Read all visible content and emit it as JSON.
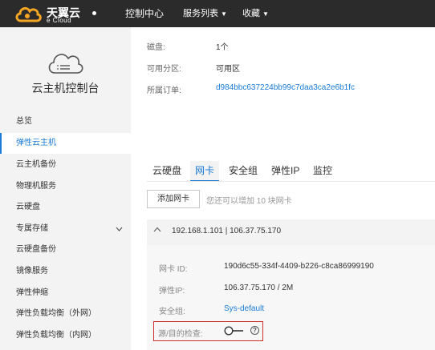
{
  "header": {
    "brand": "天翼云",
    "brand_sub": "e Cloud",
    "nav": [
      "控制中心",
      "服务列表",
      "收藏"
    ]
  },
  "sidebar": {
    "title": "云主机控制台",
    "items": [
      {
        "label": "总览"
      },
      {
        "label": "弹性云主机",
        "active": true
      },
      {
        "label": "云主机备份"
      },
      {
        "label": "物理机服务"
      },
      {
        "label": "云硬盘"
      },
      {
        "label": "专属存储",
        "expandable": true
      },
      {
        "label": "云硬盘备份"
      },
      {
        "label": "镜像服务"
      },
      {
        "label": "弹性伸缩"
      },
      {
        "label": "弹性负载均衡（外网）"
      },
      {
        "label": "弹性负载均衡（内网）"
      }
    ]
  },
  "details": [
    {
      "label": "磁盘:",
      "value": "1个"
    },
    {
      "label": "可用分区:",
      "value": "可用区"
    },
    {
      "label": "所属订单:",
      "value": "d984bbc637224bb99c7daa3ca2e6b1fc"
    }
  ],
  "tabs": [
    "云硬盘",
    "网卡",
    "安全组",
    "弹性IP",
    "监控"
  ],
  "active_tab": "网卡",
  "add_nic_button": "添加网卡",
  "add_nic_hint": "您还可以增加 10 块网卡",
  "nic": {
    "title": "192.168.1.101 | 106.37.75.170",
    "fields": [
      {
        "label": "网卡 ID:",
        "value": "190d6c55-334f-4409-b226-c8ca86999190"
      },
      {
        "label": "弹性IP:",
        "value": "106.37.75.170 / 2M"
      },
      {
        "label": "安全组:",
        "value": "Sys-default"
      }
    ],
    "source_dest_check_label": "源/目的检查:",
    "source_dest_check_enabled": false
  },
  "colors": {
    "accent": "#1a7bd6",
    "topbar": "#2b2b2b",
    "highlight": "#d12e2e",
    "logo_orange": "#f5a623"
  },
  "icons": [
    "cloud-logo-icon",
    "cloud-server-icon",
    "chevron-down-icon",
    "chevron-up-icon",
    "help-icon",
    "toggle-switch-icon"
  ]
}
